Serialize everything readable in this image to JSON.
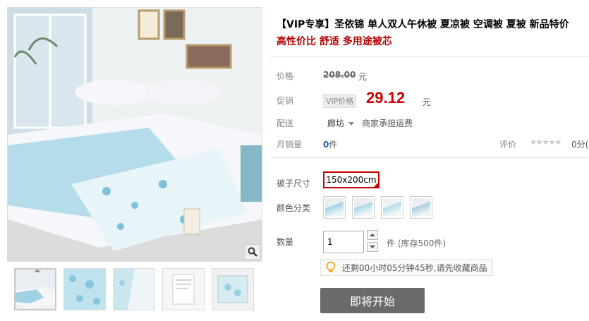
{
  "product": {
    "title": "【VIP专享】圣依锦 单人双人午休被 夏凉被 空调被 夏被 新品特价",
    "subtitle": "高性价比 舒适 多用途被芯"
  },
  "price": {
    "label": "价格",
    "original": "208.00",
    "unit": "元"
  },
  "promo": {
    "label": "促销",
    "tag": "VIP价格",
    "price": "29.12",
    "unit": "元"
  },
  "delivery": {
    "label": "配送",
    "location": "廊坊",
    "shipping": "商家承担运费"
  },
  "sales": {
    "label": "月销量",
    "count": "0",
    "count_unit": "件",
    "rating_label": "评价",
    "stars": "★★★★★",
    "score": "0分("
  },
  "options": {
    "size_label": "被子尺寸",
    "size_value": "150x200cm",
    "color_label": "颜色分类",
    "colors": [
      "light-blue-bedding-1",
      "light-blue-bedding-2",
      "light-blue-bedding-3",
      "light-blue-bedding-4"
    ],
    "quantity_label": "数量",
    "quantity_value": "1",
    "stock_text": "件 (库存500件)"
  },
  "timer": {
    "text": "还剩00小时05分钟45秒,请先收藏商品"
  },
  "buy_button": {
    "label": "即将开始"
  },
  "colors": {
    "accent_red": "#c40000",
    "promo_red": "#cc0000",
    "button_gray": "#6a6a6a"
  }
}
